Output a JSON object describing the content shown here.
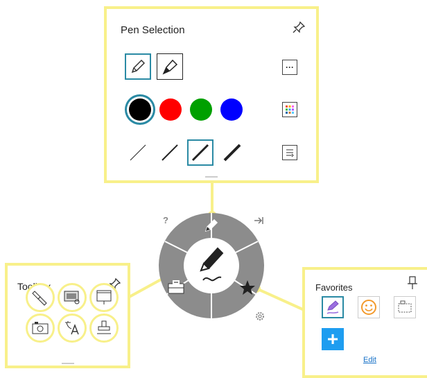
{
  "pen_selection": {
    "title": "Pen Selection",
    "icons": {
      "pin": "pin-icon",
      "pen": "pen-icon",
      "highlighter": "highlighter-icon",
      "more": "more-icon",
      "palette": "palette-icon",
      "stroke_settings": "stroke-settings-icon"
    },
    "more_label": "···",
    "colors": [
      {
        "name": "black",
        "hex": "#000000",
        "selected": true
      },
      {
        "name": "red",
        "hex": "#ff0000",
        "selected": false
      },
      {
        "name": "green",
        "hex": "#00a000",
        "selected": false
      },
      {
        "name": "blue",
        "hex": "#0000ff",
        "selected": false
      }
    ],
    "selected_stroke_index": 2
  },
  "wheel": {
    "help_label": "?",
    "icons": {
      "help": "help-icon",
      "collapse": "collapse-icon",
      "pen": "pen-icon",
      "toolbox": "toolbox-icon",
      "favorites": "star-icon",
      "settings": "gear-icon"
    }
  },
  "toolbox": {
    "title": "Toolbox",
    "tools": [
      "flashlight-icon",
      "screen-zoom-icon",
      "presentation-board-icon",
      "camera-icon",
      "translate-icon",
      "stamp-icon"
    ]
  },
  "favorites": {
    "title": "Favorites",
    "items": [
      "purple-pen-icon",
      "smiley-icon",
      "screen-capture-icon"
    ],
    "add_label": "+",
    "edit_label": "Edit"
  },
  "colors": {
    "accent_yellow": "#f8f08a",
    "selection_teal": "#2a8aa4",
    "wheel_gray": "#8c8c8c",
    "add_blue": "#1e9df0"
  }
}
